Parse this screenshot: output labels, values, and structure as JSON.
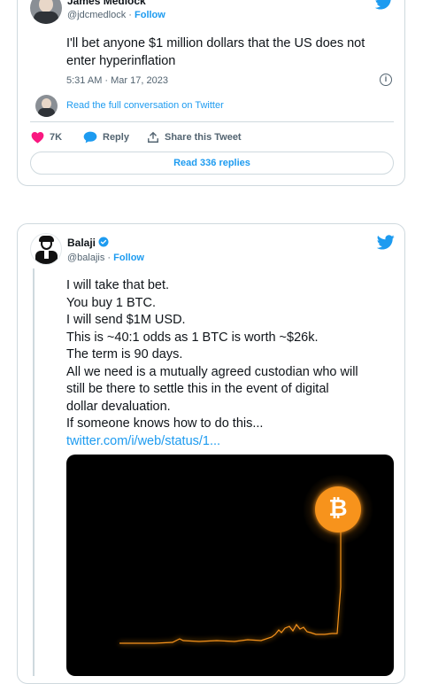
{
  "tweet1": {
    "author_name": "James Medlock",
    "handle": "@jdcmedlock",
    "follow_label": "Follow",
    "text": "I'll bet anyone $1 million dollars that the US does not enter hyperinflation",
    "timestamp": "5:31 AM · Mar 17, 2023",
    "read_full_label": "Read the full conversation on Twitter",
    "likes_count": "7K",
    "reply_label": "Reply",
    "share_label": "Share this Tweet",
    "read_replies_label": "Read 336 replies"
  },
  "tweet2": {
    "author_name": "Balaji",
    "handle": "@balajis",
    "follow_label": "Follow",
    "text_lines": [
      "I will take that bet.",
      "You buy 1 BTC.",
      "I will send $1M USD.",
      "This is ~40:1 odds as 1 BTC is worth ~$26k.",
      "The term is 90 days.",
      "All we need is a mutually agreed custodian who will",
      "still be there to settle this in the event of digital",
      "dollar devaluation.",
      "If someone knows how to do this..."
    ],
    "link_text": "twitter.com/i/web/status/1...",
    "media_logo_glyph": "₿"
  },
  "colors": {
    "brand_blue": "#1d9bf0",
    "like_pink": "#f91880",
    "bitcoin_orange": "#f7931a",
    "border": "#cfd9de",
    "muted_text": "#536471"
  },
  "icons": [
    "twitter-bird-icon",
    "verified-badge-icon",
    "info-icon",
    "heart-icon",
    "reply-bubble-icon",
    "share-icon",
    "bitcoin-logo-icon"
  ]
}
